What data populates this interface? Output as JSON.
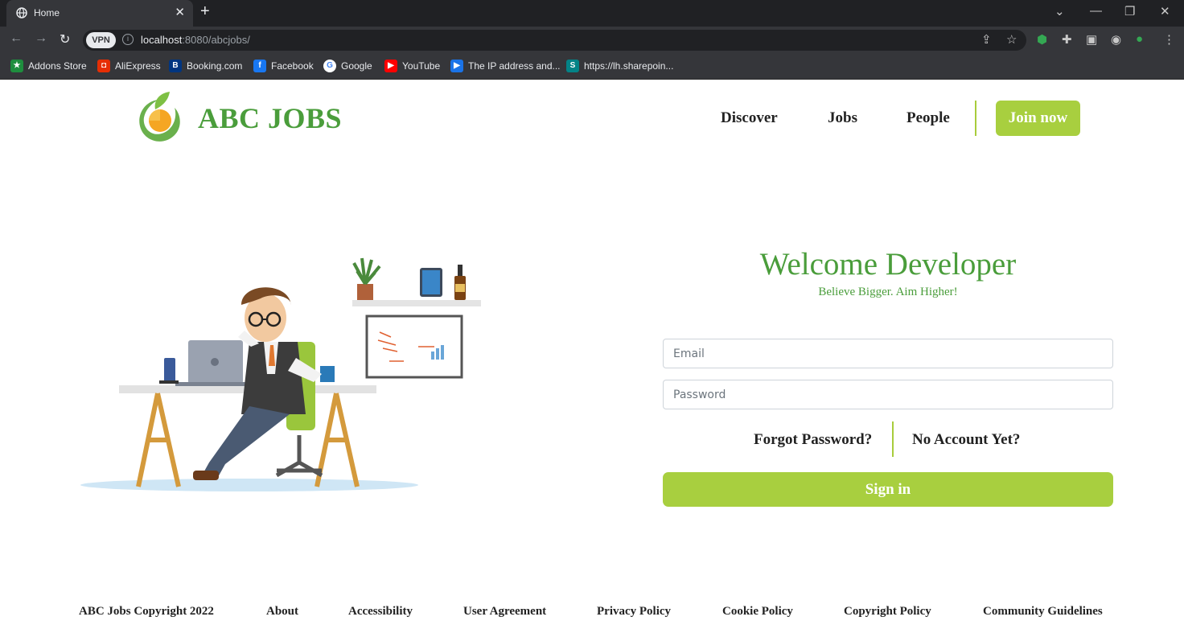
{
  "browser": {
    "tab_title": "Home",
    "url_host": "localhost",
    "url_rest": ":8080/abcjobs/",
    "vpn_label": "VPN",
    "bookmarks": [
      {
        "label": "Addons Store",
        "color": "#1e8e3e"
      },
      {
        "label": "AliExpress",
        "color": "#e62e04"
      },
      {
        "label": "Booking.com",
        "color": "#003580"
      },
      {
        "label": "Facebook",
        "color": "#1877f2"
      },
      {
        "label": "Google",
        "color": "#ffffff"
      },
      {
        "label": "YouTube",
        "color": "#ff0000"
      },
      {
        "label": "The IP address and...",
        "color": "#1a73e8"
      },
      {
        "label": "https://lh.sharepoin...",
        "color": "#038387"
      }
    ]
  },
  "header": {
    "brand": "ABC JOBS",
    "nav": [
      "Discover",
      "Jobs",
      "People"
    ],
    "join_label": "Join now"
  },
  "login": {
    "title": "Welcome Developer",
    "tagline": "Believe Bigger. Aim Higher!",
    "email_placeholder": "Email",
    "password_placeholder": "Password",
    "forgot_label": "Forgot Password?",
    "no_account_label": "No Account Yet?",
    "signin_label": "Sign in"
  },
  "footer": {
    "copyright": "ABC Jobs Copyright 2022",
    "links": [
      "About",
      "Accessibility",
      "User Agreement",
      "Privacy Policy",
      "Cookie Policy",
      "Copyright Policy",
      "Community Guidelines"
    ]
  },
  "colors": {
    "brand_green": "#4a9d3b",
    "accent_lime": "#a8cf3f",
    "chrome_dark": "#202124",
    "chrome_mid": "#35363a"
  }
}
